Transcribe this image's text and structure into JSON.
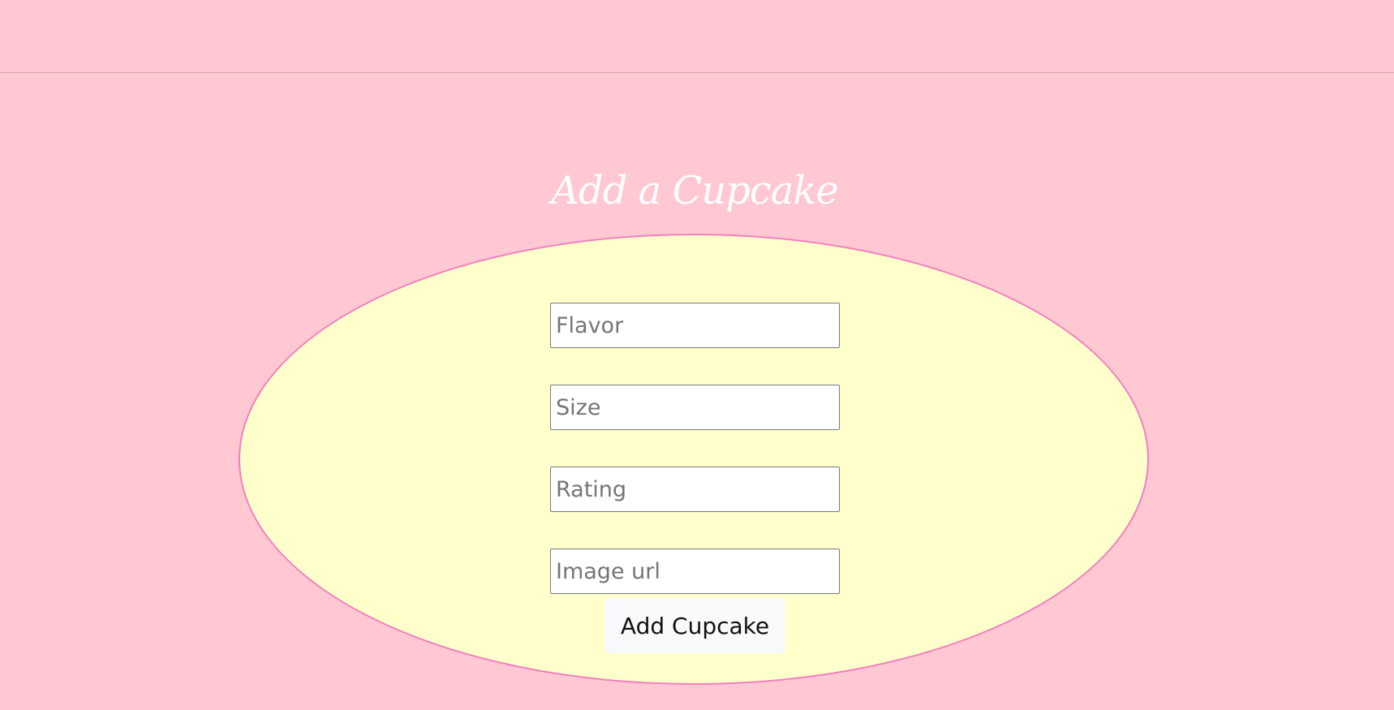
{
  "form": {
    "title": "Add a Cupcake",
    "fields": {
      "flavor_placeholder": "Flavor",
      "size_placeholder": "Size",
      "rating_placeholder": "Rating",
      "image_placeholder": "Image url",
      "flavor_value": "",
      "size_value": "",
      "rating_value": "",
      "image_value": ""
    },
    "submit_label": "Add Cupcake"
  },
  "colors": {
    "page_background": "#ffc8d3",
    "ellipse_fill": "#ffffcc",
    "ellipse_border": "#f27fc0",
    "title_color": "#ffffff",
    "button_background": "#f8f9fa"
  }
}
